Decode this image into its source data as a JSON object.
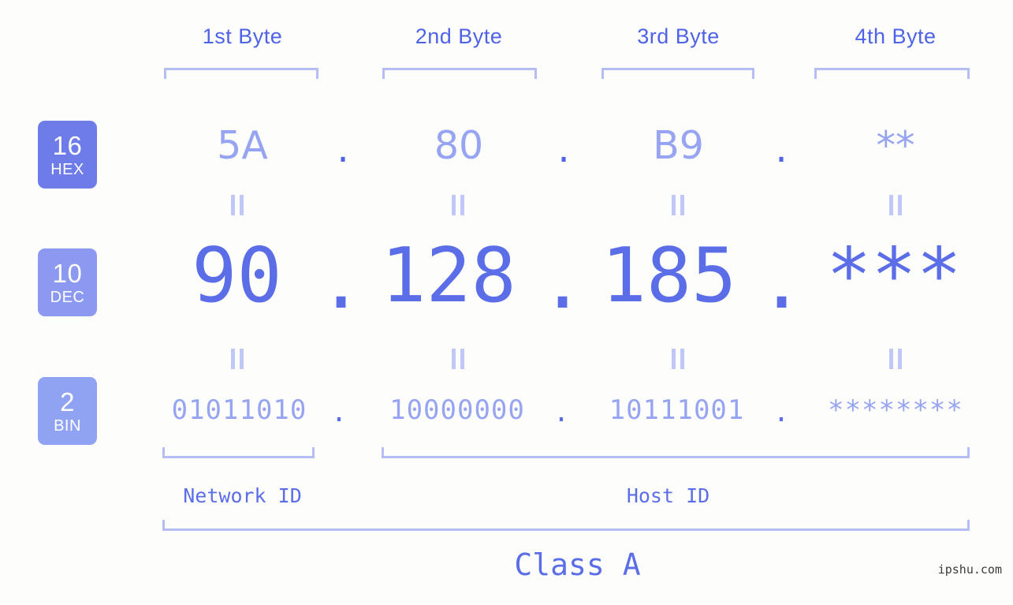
{
  "background_color": "#fdfefb",
  "accent_color": "#5b6ee8",
  "accent_light_color": "#97a4f2",
  "bracket_color": "#b5bdf5",
  "byte_headers": [
    {
      "label": "1st Byte"
    },
    {
      "label": "2nd Byte"
    },
    {
      "label": "3rd Byte"
    },
    {
      "label": "4th Byte"
    }
  ],
  "rows": {
    "hex": {
      "badge_number": "16",
      "badge_unit": "HEX",
      "badge_color": "#6e7ce9",
      "values": [
        "5A",
        "80",
        "B9",
        "**"
      ],
      "separator": "."
    },
    "dec": {
      "badge_number": "10",
      "badge_unit": "DEC",
      "badge_color": "#8b99f0",
      "values": [
        "90",
        "128",
        "185",
        "***"
      ],
      "separator": "."
    },
    "bin": {
      "badge_number": "2",
      "badge_unit": "BIN",
      "badge_color": "#8fa3f2",
      "values": [
        "01011010",
        "10000000",
        "10111001",
        "********"
      ],
      "separator": "."
    }
  },
  "equality_symbol": "=",
  "segments": {
    "network_id": "Network ID",
    "host_id": "Host ID",
    "class": "Class A"
  },
  "watermark": "ipshu.com"
}
